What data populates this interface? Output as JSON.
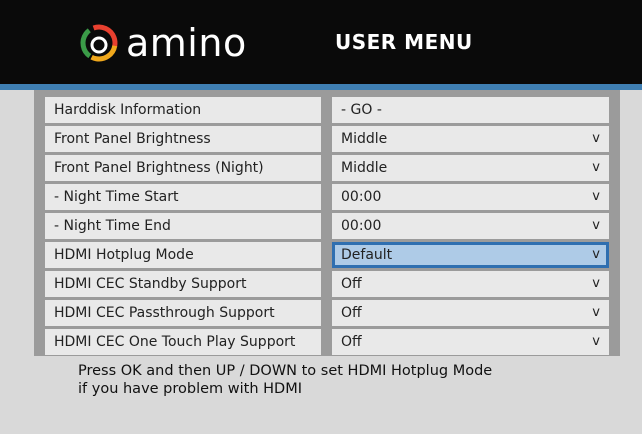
{
  "header": {
    "brand": "amino",
    "title": "USER MENU",
    "colors": {
      "background": "#0a0a0a",
      "accent": "#3f7fb3"
    }
  },
  "menu": {
    "rows": [
      {
        "label": "Harddisk Information",
        "value": "- GO -",
        "chevron": ""
      },
      {
        "label": "Front Panel Brightness",
        "value": "Middle",
        "chevron": "v"
      },
      {
        "label": "Front Panel Brightness (Night)",
        "value": "Middle",
        "chevron": "v"
      },
      {
        "label": "-  Night Time Start",
        "value": "00:00",
        "chevron": "v"
      },
      {
        "label": "-  Night Time End",
        "value": "00:00",
        "chevron": "v"
      },
      {
        "label": "HDMI Hotplug Mode",
        "value": "Default",
        "chevron": "v"
      },
      {
        "label": "HDMI CEC Standby Support",
        "value": "Off",
        "chevron": "v"
      },
      {
        "label": "HDMI CEC Passthrough Support",
        "value": "Off",
        "chevron": "v"
      },
      {
        "label": "HDMI CEC One Touch Play Support",
        "value": "Off",
        "chevron": "v"
      }
    ],
    "selected_index": 5,
    "selected_color": "#aecbe7"
  },
  "help": {
    "line1": "Press OK and then UP / DOWN to set HDMI Hotplug Mode",
    "line2": "if you have problem with HDMI"
  }
}
